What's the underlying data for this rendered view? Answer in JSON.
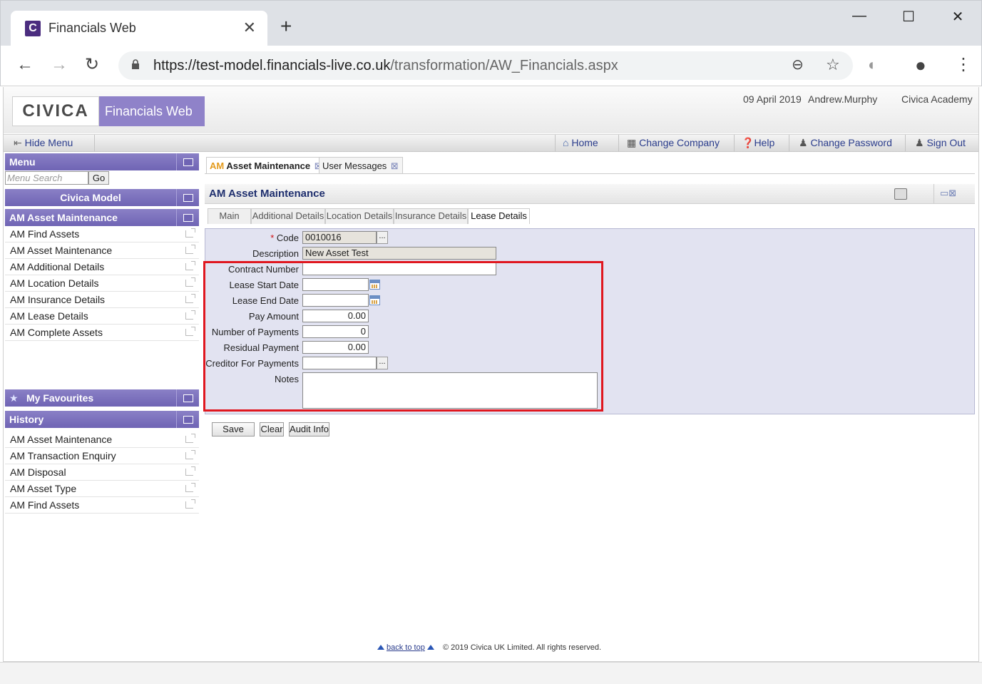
{
  "browser": {
    "tab_title": "Financials Web",
    "favicon_letter": "C",
    "url_base": "https://test-model.financials-live.co.uk",
    "url_path": "/transformation/AW_Financials.aspx"
  },
  "header": {
    "logo_text": "CIVICA",
    "product": "Financials Web",
    "date": "09 April 2019",
    "user": "Andrew.Murphy",
    "org": "Civica Academy"
  },
  "toolbar": {
    "hide_menu": "Hide Menu",
    "home": "Home",
    "change_company": "Change Company",
    "help": "Help",
    "change_password": "Change Password",
    "sign_out": "Sign Out"
  },
  "menu": {
    "title": "Menu",
    "search_placeholder": "Menu Search",
    "go": "Go",
    "group": "Civica Model",
    "section": "AM Asset Maintenance",
    "items": [
      "AM Find Assets",
      "AM Asset Maintenance",
      "AM Additional Details",
      "AM Location Details",
      "AM Insurance Details",
      "AM Lease Details",
      "AM Complete Assets"
    ]
  },
  "favourites": {
    "title": "My Favourites"
  },
  "history": {
    "title": "History",
    "items": [
      "AM Asset Maintenance",
      "AM Transaction Enquiry",
      "AM Disposal",
      "AM Asset Type",
      "AM Find Assets"
    ]
  },
  "content_tabs": [
    {
      "prefix": "AM",
      "label": "Asset Maintenance"
    },
    {
      "label": "User Messages"
    }
  ],
  "form": {
    "title": "AM Asset Maintenance",
    "subtabs": [
      "Main",
      "Additional Details",
      "Location Details",
      "Insurance Details",
      "Lease Details"
    ],
    "active_subtab": "Lease Details",
    "fields": {
      "code": {
        "label": "Code",
        "required_mark": "*",
        "value": "0010016",
        "ellipsis": "..."
      },
      "description": {
        "label": "Description",
        "value": "New Asset Test"
      },
      "contract_number": {
        "label": "Contract Number",
        "value": ""
      },
      "lease_start_date": {
        "label": "Lease Start Date",
        "value": ""
      },
      "lease_end_date": {
        "label": "Lease End Date",
        "value": ""
      },
      "pay_amount": {
        "label": "Pay Amount",
        "value": "0.00"
      },
      "number_of_payments": {
        "label": "Number of Payments",
        "value": "0"
      },
      "residual_payment": {
        "label": "Residual Payment",
        "value": "0.00"
      },
      "creditor_for_payments": {
        "label": "Creditor For Payments",
        "value": "",
        "ellipsis": "..."
      },
      "notes": {
        "label": "Notes",
        "value": ""
      }
    },
    "buttons": {
      "save": "Save",
      "clear": "Clear",
      "audit_info": "Audit Info"
    }
  },
  "footer": {
    "back_to_top": "back to top",
    "copyright": "© 2019 Civica UK Limited. All rights reserved."
  },
  "colors": {
    "menu_header": "#7a6fbd",
    "highlight_box": "#e0171f",
    "link": "#2a3c8c",
    "form_bg": "#e2e3f1"
  }
}
